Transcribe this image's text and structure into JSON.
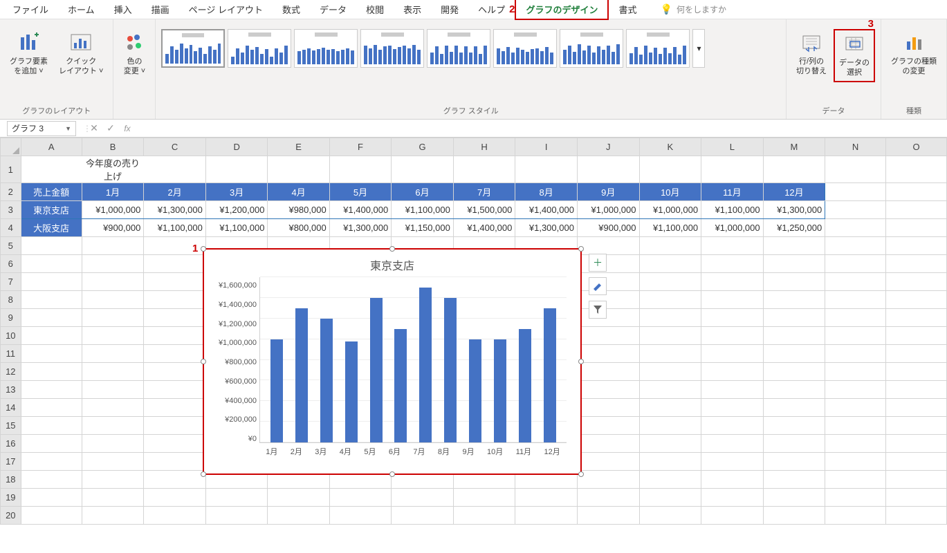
{
  "menu": {
    "items": [
      "ファイル",
      "ホーム",
      "挿入",
      "描画",
      "ページ レイアウト",
      "数式",
      "データ",
      "校閲",
      "表示",
      "開発",
      "ヘルプ",
      "グラフのデザイン",
      "書式"
    ],
    "active_index": 11,
    "tell_me": "何をしますか"
  },
  "ribbon": {
    "layout_group": {
      "label": "グラフのレイアウト",
      "add_element": "グラフ要素\nを追加 ˅",
      "quick_layout": "クイック\nレイアウト ˅"
    },
    "colors": {
      "label": "色の\n変更 ˅"
    },
    "styles_group": {
      "label": "グラフ スタイル"
    },
    "data_group": {
      "label": "データ",
      "switch": "行/列の\n切り替え",
      "select": "データの\n選択"
    },
    "type_group": {
      "label": "種類",
      "change": "グラフの種類\nの変更"
    }
  },
  "name_box": "グラフ 3",
  "columns": [
    "A",
    "B",
    "C",
    "D",
    "E",
    "F",
    "G",
    "H",
    "I",
    "J",
    "K",
    "L",
    "M",
    "N",
    "O"
  ],
  "sheet": {
    "title": "今年度の売り上げ",
    "header_label": "売上金額",
    "months": [
      "1月",
      "2月",
      "3月",
      "4月",
      "5月",
      "6月",
      "7月",
      "8月",
      "9月",
      "10月",
      "11月",
      "12月"
    ],
    "rows": [
      {
        "name": "東京支店",
        "cells": [
          "¥1,000,000",
          "¥1,300,000",
          "¥1,200,000",
          "¥980,000",
          "¥1,400,000",
          "¥1,100,000",
          "¥1,500,000",
          "¥1,400,000",
          "¥1,000,000",
          "¥1,000,000",
          "¥1,100,000",
          "¥1,300,000"
        ]
      },
      {
        "name": "大阪支店",
        "cells": [
          "¥900,000",
          "¥1,100,000",
          "¥1,100,000",
          "¥800,000",
          "¥1,300,000",
          "¥1,150,000",
          "¥1,400,000",
          "¥1,300,000",
          "¥900,000",
          "¥1,100,000",
          "¥1,000,000",
          "¥1,250,000"
        ]
      }
    ]
  },
  "callouts": {
    "c1": "1",
    "c2": "2",
    "c3": "3"
  },
  "chart_data": {
    "type": "bar",
    "title": "東京支店",
    "categories": [
      "1月",
      "2月",
      "3月",
      "4月",
      "5月",
      "6月",
      "7月",
      "8月",
      "9月",
      "10月",
      "11月",
      "12月"
    ],
    "values": [
      1000000,
      1300000,
      1200000,
      980000,
      1400000,
      1100000,
      1500000,
      1400000,
      1000000,
      1000000,
      1100000,
      1300000
    ],
    "ylim": [
      0,
      1600000
    ],
    "yticklabels": [
      "¥1,600,000",
      "¥1,400,000",
      "¥1,200,000",
      "¥1,000,000",
      "¥800,000",
      "¥600,000",
      "¥400,000",
      "¥200,000",
      "¥0"
    ]
  },
  "colors": {
    "accent": "#4472C4",
    "highlight": "#c00"
  }
}
